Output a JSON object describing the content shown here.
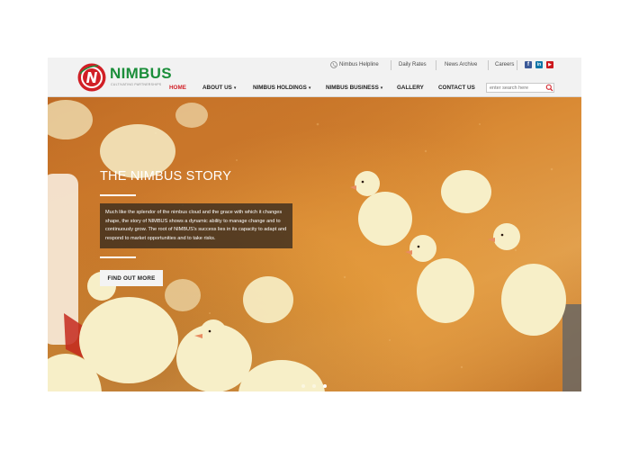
{
  "brand": {
    "name": "NIMBUS",
    "tagline": "CULTIVATING PARTNERSHIPS",
    "colors": {
      "primary_green": "#1b8e3a",
      "accent_red": "#d11f26"
    }
  },
  "utility_nav": {
    "helpline": "Nimbus Helpline",
    "daily_rates": "Daily Rates",
    "news_archive": "News Archive",
    "careers": "Careers",
    "social": {
      "facebook": "f",
      "linkedin": "in",
      "youtube": "▶"
    }
  },
  "main_nav": {
    "items": [
      {
        "label": "HOME",
        "active": true
      },
      {
        "label": "ABOUT US",
        "dropdown": true
      },
      {
        "label": "NIMBUS HOLDINGS",
        "dropdown": true
      },
      {
        "label": "NIMBUS BUSINESS",
        "dropdown": true
      },
      {
        "label": "GALLERY"
      },
      {
        "label": "CONTACT US"
      }
    ],
    "caret": "▾"
  },
  "search": {
    "placeholder": "enter search here"
  },
  "hero": {
    "title": "THE NIMBUS STORY",
    "copy": "Much like the splendor of the nimbus cloud and the grace with which it changes shape, the story of NIMBUS shows a dynamic ability to manage change and to continuously grow. The root of NIMBUS's success lies in its capacity to adapt and respond to market opportunities and to take risks.",
    "cta": "FIND OUT MORE",
    "slides": 3,
    "active_slide": 3
  }
}
